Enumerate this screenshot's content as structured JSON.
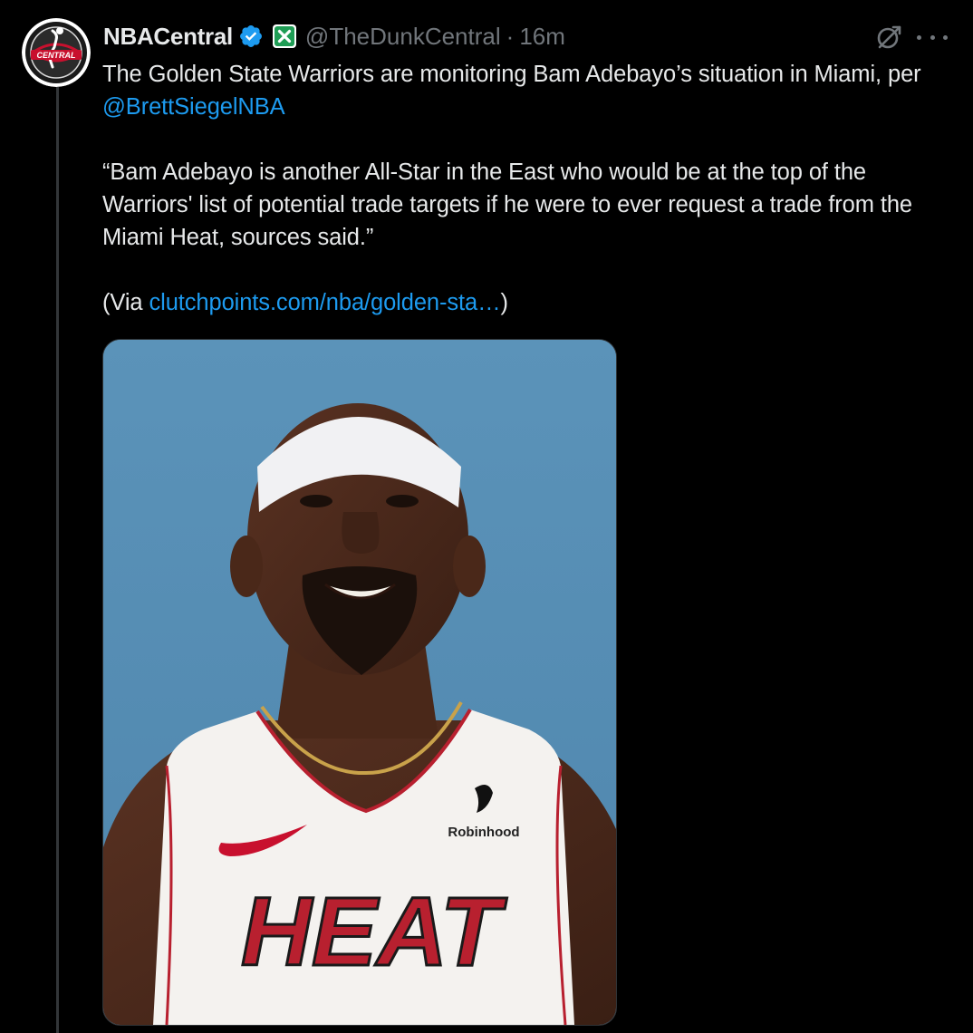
{
  "tweet": {
    "author": {
      "display_name": "NBACentral",
      "handle": "@TheDunkCentral",
      "avatar_text": "CENTRAL",
      "verified": true
    },
    "separator": "·",
    "time": "16m",
    "text": {
      "line1_prefix": "The Golden State Warriors are monitoring Bam Adebayo’s situation in Miami, per ",
      "mention": "@BrettSiegelNBA",
      "quote": "“Bam Adebayo is another All-Star in the East who would be at the top of the Warriors' list of potential trade targets if he were to ever request a trade from the Miami Heat, sources said.”",
      "via_prefix": "(Via ",
      "via_link": "clutchpoints.com/nba/golden-sta…",
      "via_suffix": ")"
    },
    "media": {
      "image_icon": "player-portrait-image",
      "jersey_sponsor": "Robinhood",
      "jersey_team": "HEAT"
    }
  },
  "icons": {
    "verified": "verified-badge-icon",
    "affiliate": "affiliate-badge-icon",
    "grok": "grok-icon",
    "more": "more-options-icon"
  },
  "colors": {
    "background": "#000000",
    "text": "#e7e9ea",
    "secondary": "#71767b",
    "link": "#1d9bf0",
    "verified": "#1d9bf0",
    "image_bg": "#5990b6"
  }
}
